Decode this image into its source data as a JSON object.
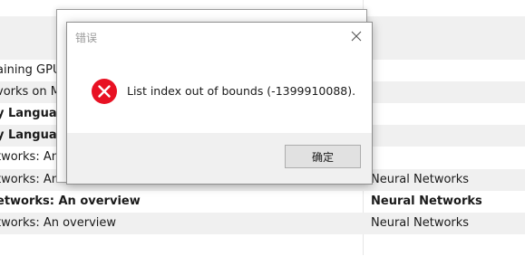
{
  "background_list": {
    "rows": [
      {
        "title": "",
        "category": "",
        "shaded": true,
        "bold": false
      },
      {
        "title": "",
        "category": "",
        "shaded": false,
        "bold": false
      },
      {
        "title": "",
        "category": "",
        "shaded": true,
        "bold": false
      },
      {
        "title": "aining GPU Ne",
        "category": "",
        "shaded": false,
        "bold": false
      },
      {
        "title": "vorks on Mu",
        "category": "",
        "shaded": true,
        "bold": false
      },
      {
        "title": "y Language",
        "category": "",
        "shaded": false,
        "bold": true
      },
      {
        "title": "y Language",
        "category": "",
        "shaded": true,
        "bold": true
      },
      {
        "title": "tworks: An O",
        "category": "",
        "shaded": false,
        "bold": false
      },
      {
        "title": "tworks: An overview",
        "category": "Neural Networks",
        "shaded": true,
        "bold": false
      },
      {
        "title": "etworks: An overview",
        "category": "Neural Networks",
        "shaded": false,
        "bold": true
      },
      {
        "title": "tworks: An overview",
        "category": "Neural Networks",
        "shaded": true,
        "bold": false
      },
      {
        "title": "",
        "category": "",
        "shaded": false,
        "bold": false
      }
    ]
  },
  "error_dialog": {
    "title": "错误",
    "message": "List index out of bounds (-1399910088).",
    "ok_label": "确定",
    "close_icon": "close-icon",
    "error_icon": "error-icon",
    "error_color": "#e81123"
  }
}
